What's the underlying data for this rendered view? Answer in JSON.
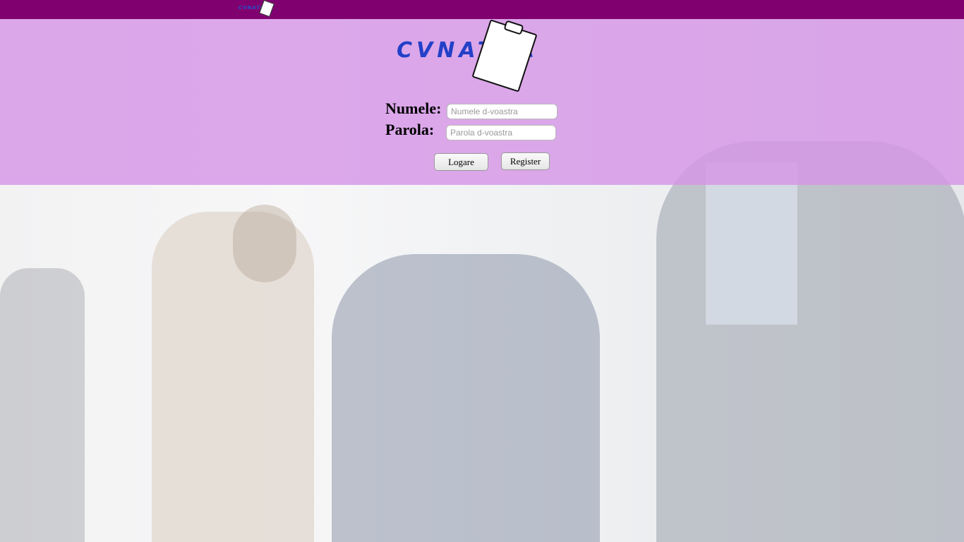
{
  "topbar": {
    "mini_logo_text": "CVNATOR",
    "color": "#800070"
  },
  "logo": {
    "text": "CVNATOR",
    "accent": "#2340c8",
    "icon": "clipboard-icon"
  },
  "login": {
    "name_label": "Numele:",
    "name_placeholder": "Numele d-voastra",
    "password_label": "Parola:",
    "password_placeholder": "Parola d-voastra",
    "login_button": "Logare",
    "register_button": "Register"
  },
  "header_color": "#d696e6"
}
